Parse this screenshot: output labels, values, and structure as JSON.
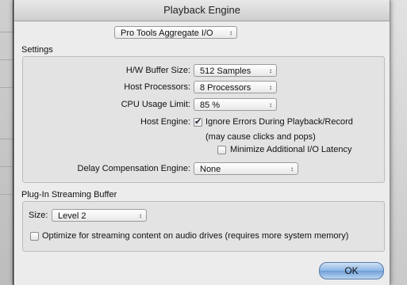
{
  "window": {
    "title": "Playback Engine"
  },
  "engine": {
    "selected": "Pro Tools Aggregate I/O"
  },
  "settings": {
    "section_label": "Settings",
    "buffer": {
      "label": "H/W Buffer Size:",
      "value": "512 Samples"
    },
    "processors": {
      "label": "Host Processors:",
      "value": "8 Processors"
    },
    "cpu": {
      "label": "CPU Usage Limit:",
      "value": "85 %"
    },
    "host_engine": {
      "label": "Host Engine:",
      "ignore_errors": {
        "label": "Ignore Errors During Playback/Record",
        "checked": true
      },
      "note": "(may cause clicks and pops)",
      "minimize_latency": {
        "label": "Minimize Additional I/O Latency",
        "checked": false
      }
    },
    "delay_comp": {
      "label": "Delay Compensation Engine:",
      "value": "None"
    }
  },
  "streaming": {
    "section_label": "Plug-In Streaming Buffer",
    "size": {
      "label": "Size:",
      "value": "Level 2"
    },
    "optimize": {
      "label": "Optimize for streaming content on audio drives (requires more system memory)",
      "checked": false
    }
  },
  "buttons": {
    "ok": "OK"
  },
  "icons": {
    "popup_arrows": "updown-chevron-icon",
    "checkmark": "checkmark-icon"
  },
  "colors": {
    "ok_button": "#8db5e3",
    "window_bg": "#ececec"
  }
}
